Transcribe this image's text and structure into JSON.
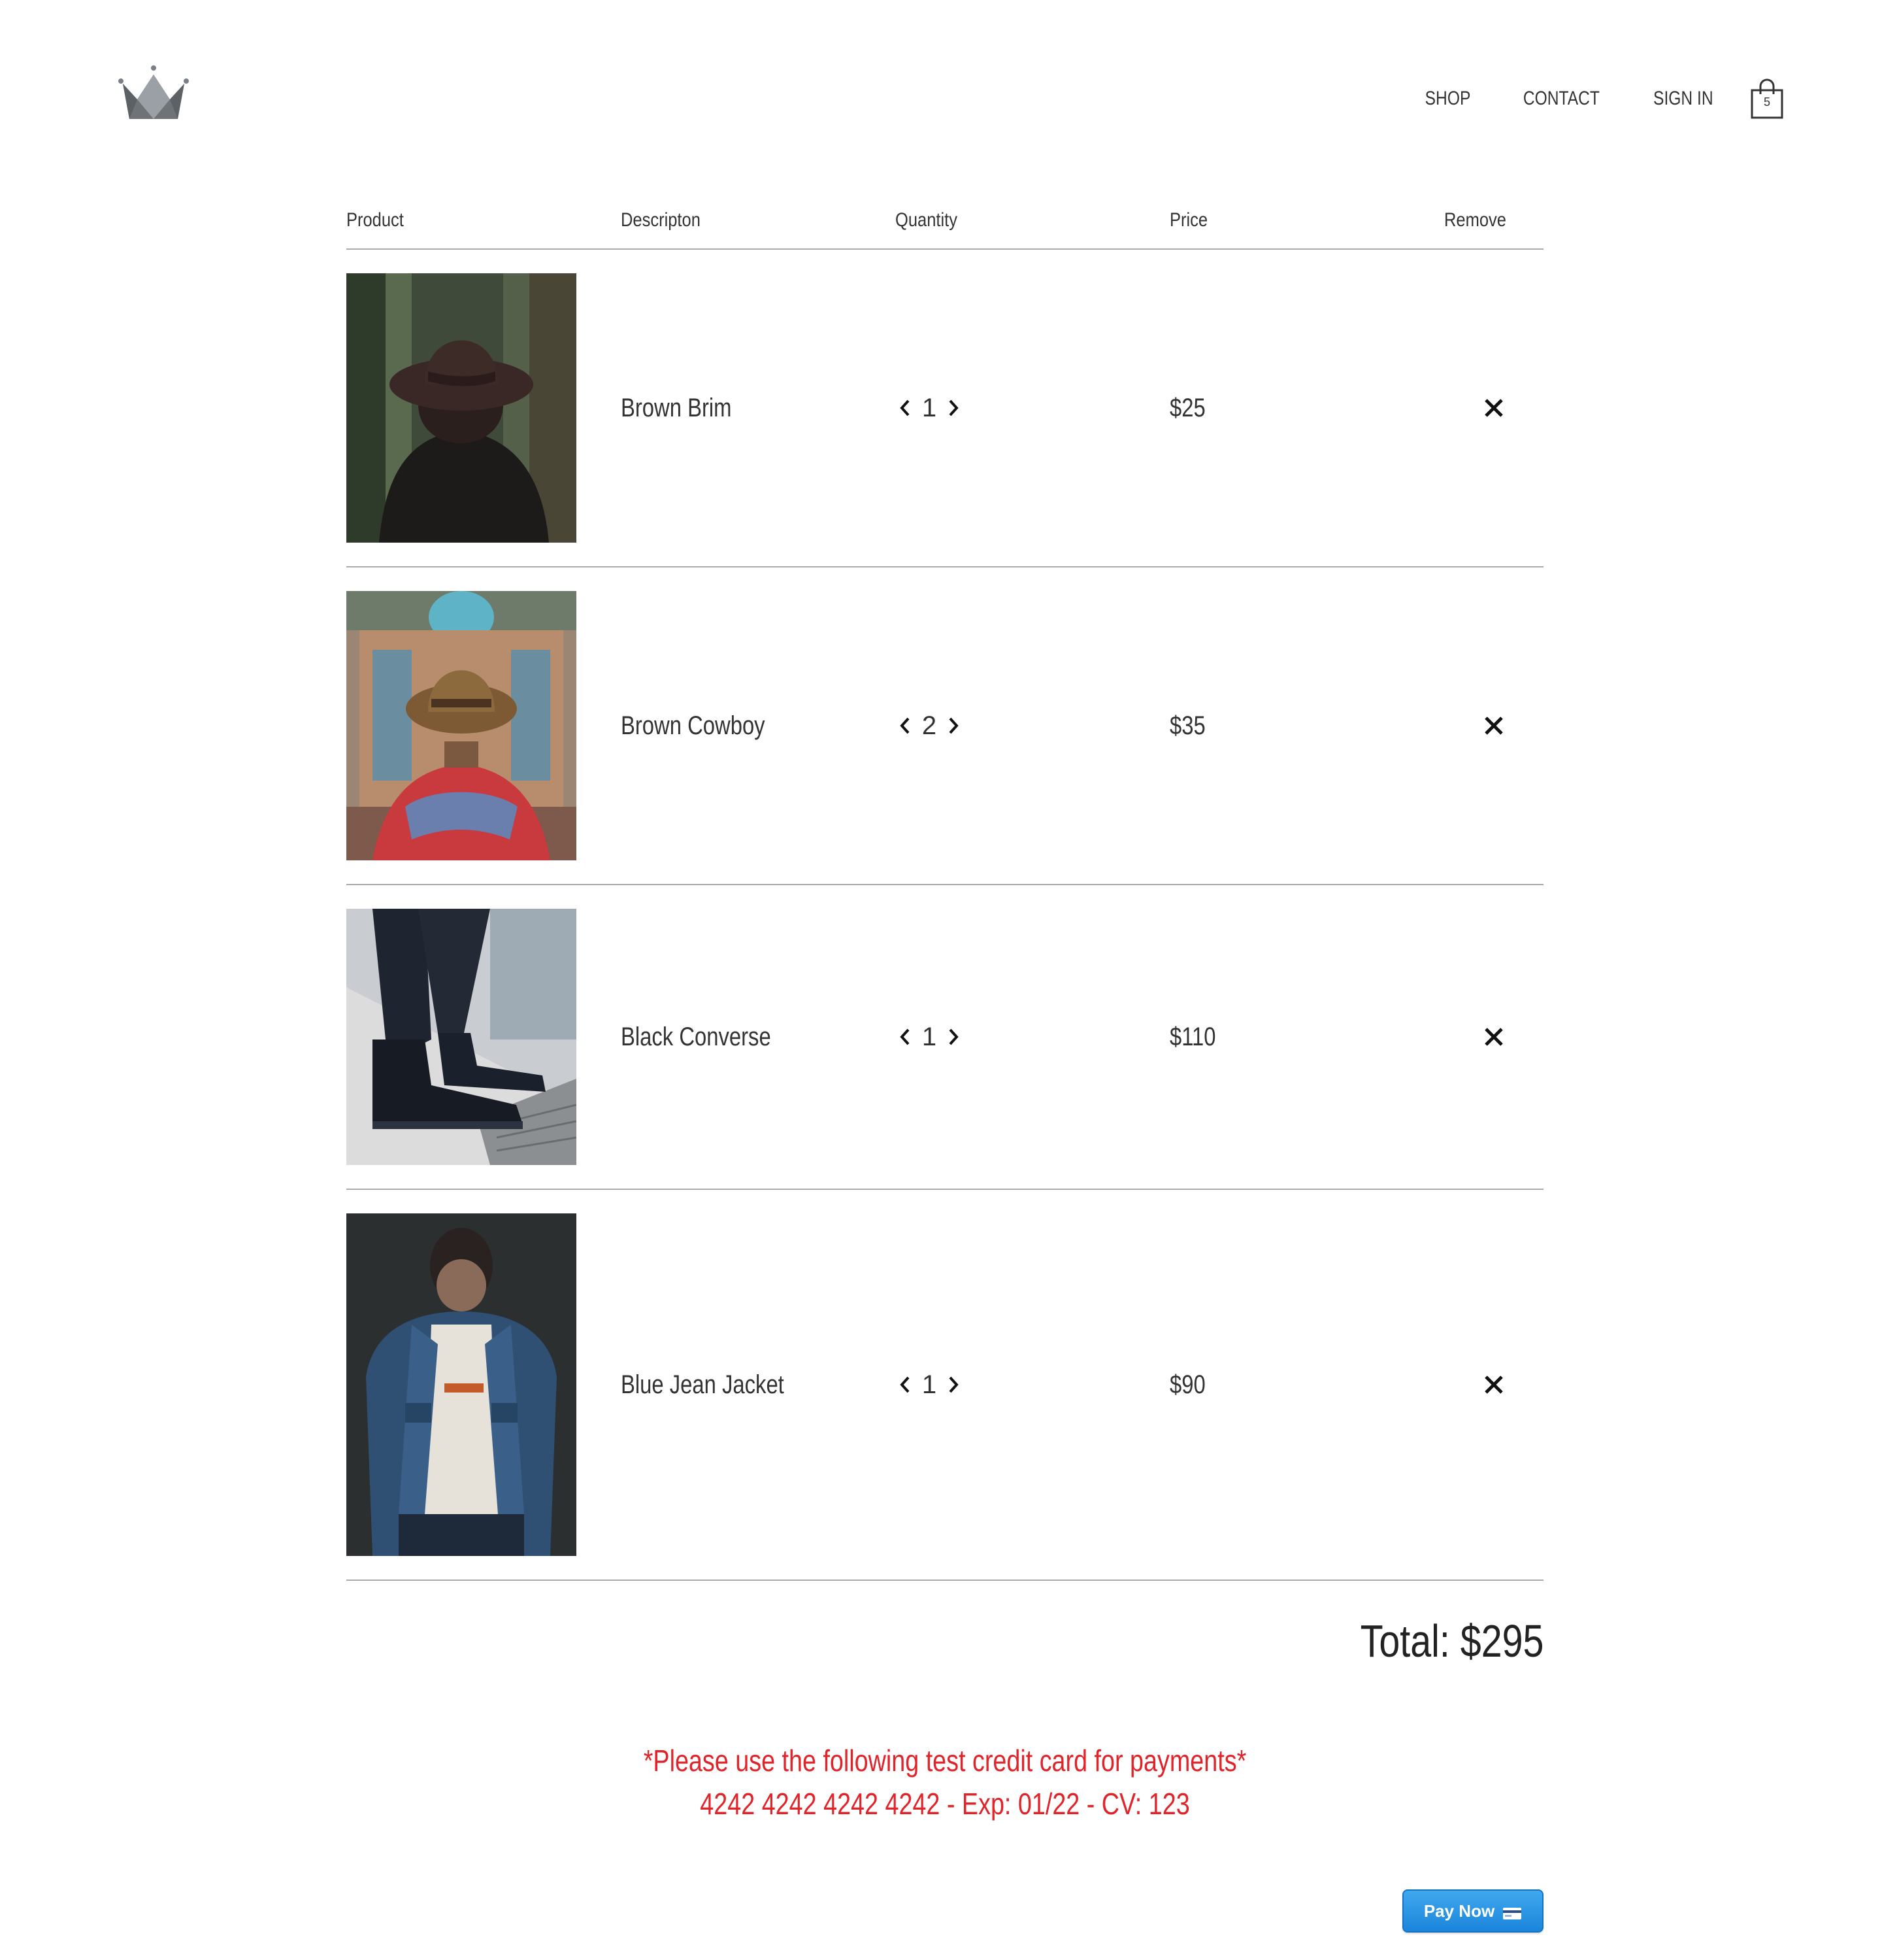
{
  "header": {
    "logo_icon": "crown-icon",
    "nav": {
      "shop": "SHOP",
      "contact": "CONTACT",
      "sign_in": "SIGN IN"
    },
    "cart_icon": "shopping-bag-icon",
    "cart_count": "5"
  },
  "table": {
    "headers": [
      "Product",
      "Descripton",
      "Quantity",
      "Price",
      "Remove"
    ],
    "items": [
      {
        "name": "Brown Brim",
        "quantity": "1",
        "price": "$25",
        "image": "woman-in-brown-hat-photo"
      },
      {
        "name": "Brown Cowboy",
        "quantity": "2",
        "price": "$35",
        "image": "person-in-cowboy-hat-photo"
      },
      {
        "name": "Black Converse",
        "quantity": "1",
        "price": "$110",
        "image": "black-sneakers-on-stairs-photo"
      },
      {
        "name": "Blue Jean Jacket",
        "quantity": "1",
        "price": "$90",
        "image": "man-in-denim-jacket-photo"
      }
    ]
  },
  "total": "Total: $295",
  "warning": {
    "line1": "*Please use the following test credit card for payments*",
    "line2": "4242 4242 4242 4242 - Exp: 01/22 - CV: 123"
  },
  "pay_button": {
    "label": "Pay Now",
    "icon": "credit-card-icon"
  },
  "colors": {
    "warning": "#e0242a",
    "pay_button": "#1b85db",
    "divider": "#a9a9a9",
    "text": "#333333"
  }
}
